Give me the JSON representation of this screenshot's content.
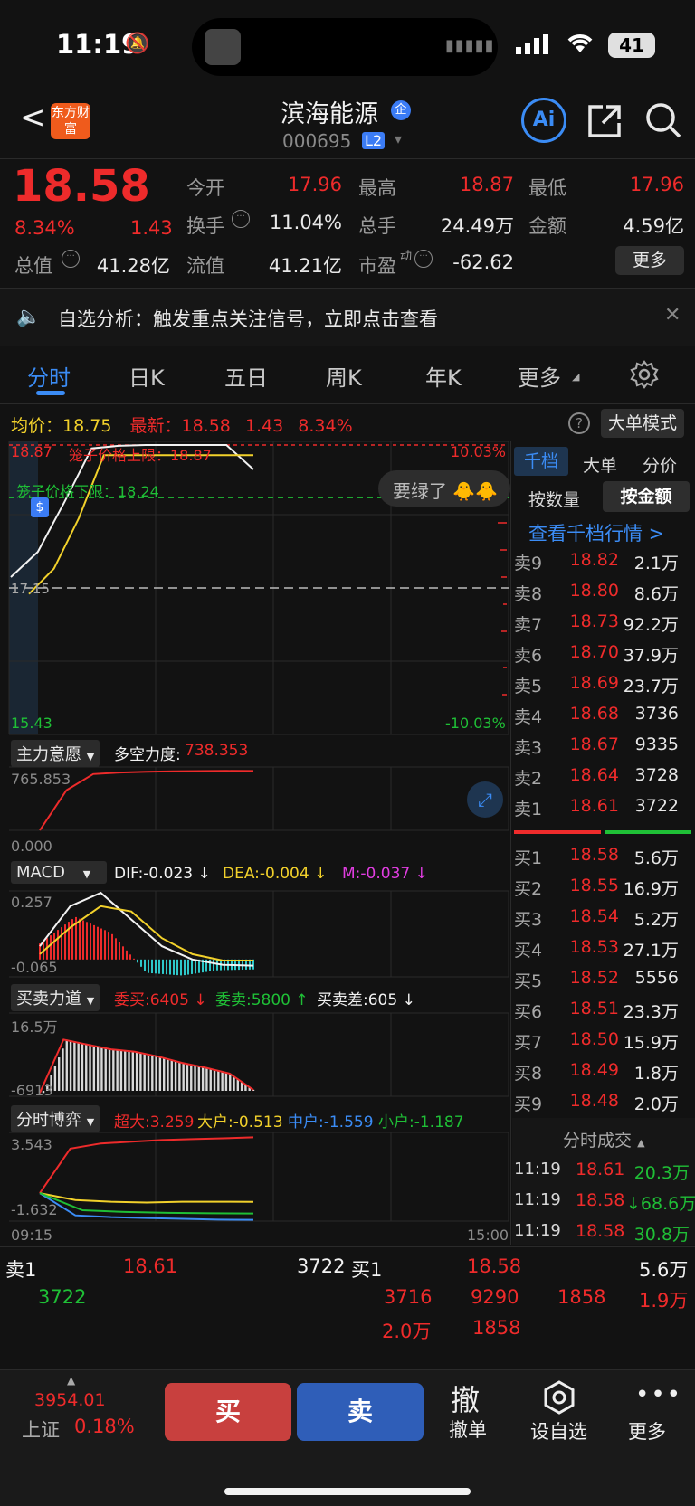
{
  "status_bar": {
    "time": "11:19",
    "battery": "41"
  },
  "header": {
    "back": "<",
    "logo_text": "东方财富",
    "stock_name": "滨海能源",
    "corp_badge": "企",
    "stock_code": "000695",
    "level_badge": "L2",
    "ai_label": "Ai"
  },
  "quote": {
    "price": "18.58",
    "change_pct": "8.34%",
    "change_amt": "1.43",
    "fields": [
      {
        "label": "今开",
        "value": "17.96",
        "color": "#ee2b2b"
      },
      {
        "label": "最高",
        "value": "18.87",
        "color": "#ee2b2b"
      },
      {
        "label": "最低",
        "value": "17.96",
        "color": "#ee2b2b"
      },
      {
        "label": "换手",
        "value": "11.04%",
        "color": "#e8e8e8"
      },
      {
        "label": "总手",
        "value": "24.49万",
        "color": "#e8e8e8"
      },
      {
        "label": "金额",
        "value": "4.59亿",
        "color": "#e8e8e8"
      },
      {
        "label": "总值",
        "value": "41.28亿",
        "color": "#e8e8e8"
      },
      {
        "label": "流值",
        "value": "41.21亿",
        "color": "#e8e8e8"
      },
      {
        "label": "市盈",
        "value": "-62.62",
        "color": "#e8e8e8"
      }
    ],
    "pe_sup": "动",
    "more_button": "更多"
  },
  "notice": {
    "text": "自选分析：触发重点关注信号，立即点击查看"
  },
  "tabs": [
    "分时",
    "日K",
    "五日",
    "周K",
    "年K",
    "更多"
  ],
  "active_tab": "分时",
  "price_bar": {
    "avg_label": "均价：",
    "avg": "18.75",
    "latest_label": "最新：",
    "latest": "18.58",
    "chg": "1.43",
    "pct": "8.34%",
    "mode_button": "大单模式"
  },
  "chart_labels": {
    "top_price": "18.87",
    "upper_limit": "笼子价格上限：18.87",
    "lower_limit": "笼子价格下限：18.24",
    "mid_price": "17.15",
    "bottom_price": "15.43",
    "top_pct": "10.03%",
    "bottom_pct": "-10.03%",
    "start_time": "09:15",
    "end_time": "15:00",
    "bubble": "要绿了"
  },
  "chart_data": [
    {
      "type": "line",
      "title": "分时",
      "x": [
        "09:15",
        "09:25",
        "09:30",
        "09:35",
        "09:40",
        "09:50",
        "10:00",
        "10:30",
        "11:00",
        "11:19"
      ],
      "series": [
        {
          "values": [
            17.3,
            17.6,
            18.2,
            18.83,
            18.86,
            18.87,
            18.87,
            18.87,
            18.87,
            18.58
          ]
        }
      ],
      "ylim": [
        15.43,
        18.87
      ]
    },
    {
      "type": "line",
      "title": "主力意愿",
      "ylim": [
        0.0,
        765.853
      ],
      "series": [
        {
          "name": "多空力度",
          "values": [
            0,
            500,
            700,
            720,
            730,
            735,
            738,
            740,
            738.353
          ]
        }
      ]
    },
    {
      "type": "bar",
      "title": "MACD",
      "ylim": [
        -0.065,
        0.257
      ],
      "series": [
        {
          "name": "DIF",
          "values": [
            0.05,
            0.2,
            0.25,
            0.15,
            0.05,
            0.0,
            -0.02,
            -0.023
          ]
        },
        {
          "name": "DEA",
          "values": [
            0.02,
            0.12,
            0.2,
            0.18,
            0.08,
            0.02,
            -0.004,
            -0.004
          ]
        },
        {
          "name": "M",
          "values": [
            0.06,
            0.16,
            0.1,
            -0.05,
            -0.06,
            -0.04,
            -0.037
          ]
        }
      ]
    },
    {
      "type": "area",
      "title": "买卖力道",
      "ylim": [
        -6913,
        165000
      ],
      "series": [
        {
          "name": "委买",
          "values": [
            0,
            110000,
            100000,
            90000,
            85000,
            75000,
            62000,
            52000,
            40000,
            6405
          ]
        },
        {
          "name": "委卖",
          "values": [
            0,
            0,
            0,
            0,
            0,
            0,
            0,
            0,
            0,
            5800
          ]
        }
      ]
    },
    {
      "type": "line",
      "title": "分时博弈",
      "ylim": [
        -1.632,
        3.543
      ],
      "series": [
        {
          "name": "超大",
          "values": [
            0,
            2.6,
            2.9,
            3.0,
            3.1,
            3.15,
            3.2,
            3.259
          ]
        },
        {
          "name": "大户",
          "values": [
            0,
            -0.4,
            -0.5,
            -0.55,
            -0.5,
            -0.5,
            -0.513
          ]
        },
        {
          "name": "中户",
          "values": [
            0,
            -1.3,
            -1.4,
            -1.45,
            -1.5,
            -1.55,
            -1.559
          ]
        },
        {
          "name": "小户",
          "values": [
            0,
            -1.0,
            -1.1,
            -1.15,
            -1.18,
            -1.187
          ]
        }
      ]
    }
  ],
  "panels": {
    "p1": {
      "title": "主力意愿",
      "ind_label": "多空力度:",
      "ind_val": "738.353",
      "max": "765.853",
      "min": "0.000"
    },
    "p2": {
      "title": "MACD",
      "dif": "DIF:-0.023 ↓",
      "dea": "DEA:-0.004 ↓",
      "m": "M:-0.037 ↓",
      "max": "0.257",
      "min": "-0.065"
    },
    "p3": {
      "title": "买卖力道",
      "buy": "委买:6405 ↓",
      "sell": "委卖:5800 ↑",
      "diff": "买卖差:605 ↓",
      "max": "16.5万",
      "min": "-6913"
    },
    "p4": {
      "title": "分时博弈",
      "super": "超大:3.259",
      "big": "大户:-0.513",
      "mid": "中户:-1.559",
      "small": "小户:-1.187",
      "max": "3.543",
      "min": "-1.632"
    }
  },
  "side": {
    "tabs": [
      "千档",
      "大单",
      "分价"
    ],
    "sub_tabs": [
      "按数量",
      "按金额"
    ],
    "link": "查看千档行情 >"
  },
  "asks": [
    {
      "label": "卖9",
      "price": "18.82",
      "vol": "2.1万"
    },
    {
      "label": "卖8",
      "price": "18.80",
      "vol": "8.6万"
    },
    {
      "label": "卖7",
      "price": "18.73",
      "vol": "92.2万"
    },
    {
      "label": "卖6",
      "price": "18.70",
      "vol": "37.9万"
    },
    {
      "label": "卖5",
      "price": "18.69",
      "vol": "23.7万"
    },
    {
      "label": "卖4",
      "price": "18.68",
      "vol": "3736"
    },
    {
      "label": "卖3",
      "price": "18.67",
      "vol": "9335"
    },
    {
      "label": "卖2",
      "price": "18.64",
      "vol": "3728"
    },
    {
      "label": "卖1",
      "price": "18.61",
      "vol": "3722"
    }
  ],
  "bids": [
    {
      "label": "买1",
      "price": "18.58",
      "vol": "5.6万"
    },
    {
      "label": "买2",
      "price": "18.55",
      "vol": "16.9万"
    },
    {
      "label": "买3",
      "price": "18.54",
      "vol": "5.2万"
    },
    {
      "label": "买4",
      "price": "18.53",
      "vol": "27.1万"
    },
    {
      "label": "买5",
      "price": "18.52",
      "vol": "5556"
    },
    {
      "label": "买6",
      "price": "18.51",
      "vol": "23.3万"
    },
    {
      "label": "买7",
      "price": "18.50",
      "vol": "15.9万"
    },
    {
      "label": "买8",
      "price": "18.49",
      "vol": "1.8万"
    },
    {
      "label": "买9",
      "price": "18.48",
      "vol": "2.0万"
    }
  ],
  "trades": {
    "title": "分时成交",
    "rows": [
      {
        "time": "11:19",
        "price": "18.61",
        "vol": "20.3万"
      },
      {
        "time": "11:19",
        "price": "18.58",
        "vol": "↓68.6万"
      },
      {
        "time": "11:19",
        "price": "18.58",
        "vol": "30.8万"
      }
    ]
  },
  "queue": {
    "left_label": "卖1",
    "left_price": "18.61",
    "left_vol": "3722",
    "left_items": [
      "3722"
    ],
    "right_label": "买1",
    "right_price": "18.58",
    "right_vol": "5.6万",
    "right_items": [
      "3716",
      "9290",
      "1858",
      "1.9万",
      "2.0万",
      "1858"
    ]
  },
  "bottom": {
    "index_val": "3954.01",
    "index_name": "上证",
    "index_pct": "0.18%",
    "buy": "买",
    "sell": "卖",
    "cancel_icon": "撤",
    "cancel": "撤单",
    "watch": "设自选",
    "more": "更多"
  }
}
